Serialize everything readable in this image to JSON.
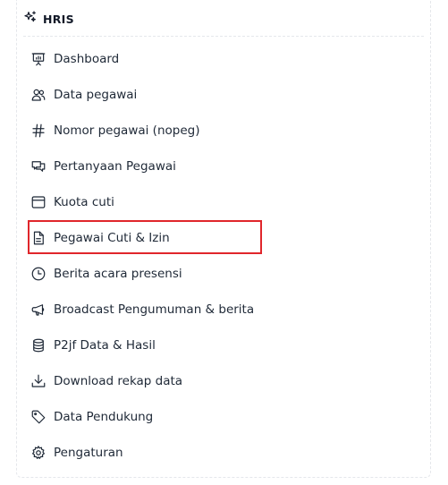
{
  "header": {
    "title": "HRIS",
    "icon": "sparkles-icon"
  },
  "menu": {
    "items": [
      {
        "label": "Dashboard",
        "icon": "presentation-chart-icon"
      },
      {
        "label": "Data pegawai",
        "icon": "users-icon"
      },
      {
        "label": "Nomor pegawai (nopeg)",
        "icon": "hash-icon"
      },
      {
        "label": "Pertanyaan Pegawai",
        "icon": "chat-bubbles-icon"
      },
      {
        "label": "Kuota cuti",
        "icon": "window-icon"
      },
      {
        "label": "Pegawai Cuti & Izin",
        "icon": "document-icon",
        "highlighted": true
      },
      {
        "label": "Berita acara presensi",
        "icon": "clock-icon"
      },
      {
        "label": "Broadcast Pengumuman & berita",
        "icon": "megaphone-icon"
      },
      {
        "label": "P2jf Data & Hasil",
        "icon": "database-icon"
      },
      {
        "label": "Download rekap data",
        "icon": "download-icon"
      },
      {
        "label": "Data Pendukung",
        "icon": "tag-icon"
      },
      {
        "label": "Pengaturan",
        "icon": "gear-icon"
      }
    ]
  },
  "colors": {
    "highlight_border": "#e0262b",
    "text": "#1f2937"
  }
}
